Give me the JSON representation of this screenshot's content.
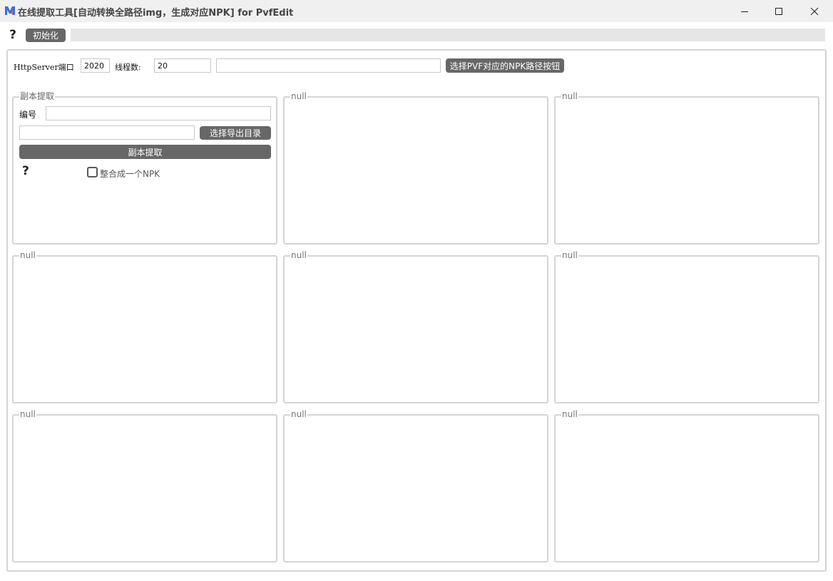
{
  "window": {
    "title": "在线提取工具[自动转换全路径img，生成对应NPK] for PvfEdit",
    "icon": "app-logo-m-icon",
    "minimize_icon": "minimize-icon",
    "maximize_icon": "maximize-icon",
    "close_icon": "close-icon"
  },
  "toolbar": {
    "help_label": "?",
    "init_label": "初始化",
    "progress": 0
  },
  "settings": {
    "port_label": "HttpServer端口",
    "port_value": "2020",
    "threads_label": "线程数:",
    "threads_value": "20",
    "npk_path_value": "",
    "npk_path_button": "选择PVF对应的NPK路径按钮"
  },
  "extract_panel": {
    "title": "副本提取",
    "id_label": "编号",
    "id_value": "",
    "export_dir_value": "",
    "export_dir_button": "选择导出目录",
    "extract_button": "副本提取",
    "help_label": "?",
    "merge_checkbox_label": "整合成一个NPK",
    "merge_checked": false
  },
  "panels": [
    "null",
    "null",
    "null",
    "null",
    "null",
    "null",
    "null",
    "null"
  ],
  "colors": {
    "button_bg": "#676767",
    "button_text": "#ffffff",
    "frame_border": "#d4d4d4",
    "titlebar_bg": "#f0f0f0"
  }
}
